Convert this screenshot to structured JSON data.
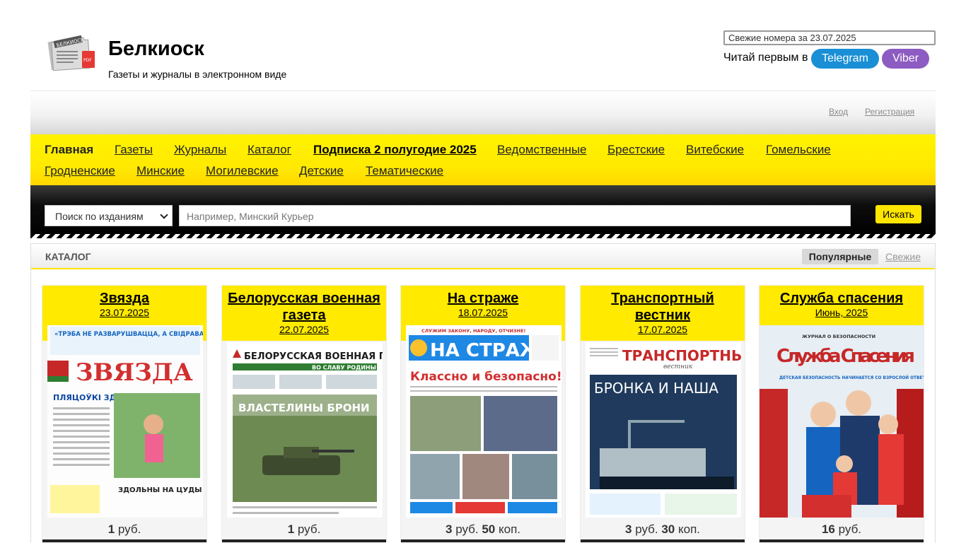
{
  "header": {
    "site_title": "Белкиоск",
    "site_subtitle": "Газеты и журналы в электронном виде",
    "logo_badge": "БЕЛКИОСК",
    "logo_pdf": "PDF",
    "fresh_select": "Свежие номера за 23.07.2025",
    "read_first": "Читай первым в",
    "telegram": "Telegram",
    "viber": "Viber"
  },
  "auth": {
    "login": "Вход",
    "register": "Регистрация"
  },
  "nav": {
    "home": "Главная",
    "newspapers": "Газеты",
    "magazines": "Журналы",
    "catalog": "Каталог",
    "subscription": "Подписка 2 полугодие 2025",
    "departmental": "Ведомственные",
    "brest": "Брестские",
    "vitebsk": "Витебские",
    "gomel": "Гомельские",
    "grodno": "Гродненские",
    "minsk": "Минские",
    "mogilev": "Могилевские",
    "kids": "Детские",
    "thematic": "Тематические"
  },
  "search": {
    "scope": "Поиск по изданиям",
    "placeholder": "Например, Минский Курьер",
    "button": "Искать"
  },
  "catalog": {
    "title": "КАТАЛОГ",
    "tab_popular": "Популярные",
    "tab_fresh": "Свежие",
    "items": [
      {
        "title": "Звязда",
        "date": "23.07.2025",
        "price_major": "1",
        "price_major_unit": "руб.",
        "price_minor": "",
        "price_minor_unit": "",
        "cover_headline": "ЗВЯЗДА",
        "cover_top": "«ТРЭБА НЕ РАЗВАРУШВАЦЦА, А СВІДРАВАЦЬ. АЛЕ СВІДРАВАЦЬ З РОЗУМАМ»",
        "cover_story": "ПЛЯЦОЎКІ ЗДАРОЎЯ",
        "cover_story2": "ЗДОЛЬНЫ НА ЦУДЫ"
      },
      {
        "title": "Белорусская военная газета",
        "date": "22.07.2025",
        "price_major": "1",
        "price_major_unit": "руб.",
        "price_minor": "",
        "price_minor_unit": "",
        "cover_headline": "БЕЛОРУССКАЯ ВОЕННАЯ ГАЗЕТА",
        "cover_top": "ВО СЛАВУ РОДИНЫ",
        "cover_story": "ВЛАСТЕЛИНЫ БРОНИ",
        "cover_story2": ""
      },
      {
        "title": "На страже",
        "date": "18.07.2025",
        "price_major": "3",
        "price_major_unit": "руб.",
        "price_minor": "50",
        "price_minor_unit": "коп.",
        "cover_headline": "НА СТРАЖЕ",
        "cover_top": "СЛУЖИМ ЗАКОНУ, НАРОДУ, ОТЧИЗНЕ!",
        "cover_story": "Классно и безопасно!",
        "cover_story2": ""
      },
      {
        "title": "Транспортный вестник",
        "date": "17.07.2025",
        "price_major": "3",
        "price_major_unit": "руб.",
        "price_minor": "30",
        "price_minor_unit": "коп.",
        "cover_headline": "ТРАНСПОРТНЫЙ",
        "cover_top": "вестник",
        "cover_story": "БРОНКА И НАША",
        "cover_story2": ""
      },
      {
        "title": "Служба спасения",
        "date": "Июнь, 2025",
        "price_major": "16",
        "price_major_unit": "руб.",
        "price_minor": "",
        "price_minor_unit": "",
        "cover_headline": "Служба Спасения",
        "cover_top": "ЖУРНАЛ О БЕЗОПАСНОСТИ",
        "cover_story": "ДЕТСКАЯ БЕЗОПАСНОСТЬ НАЧИНАЕТСЯ СО ВЗРОСЛОЙ ОТВЕТСТВЕННОСТИ",
        "cover_story2": ""
      }
    ]
  },
  "colors": {
    "accent_yellow": "#ffea00",
    "telegram": "#1a8fd6",
    "viber": "#8d5cc2",
    "search_band": "#000000"
  }
}
